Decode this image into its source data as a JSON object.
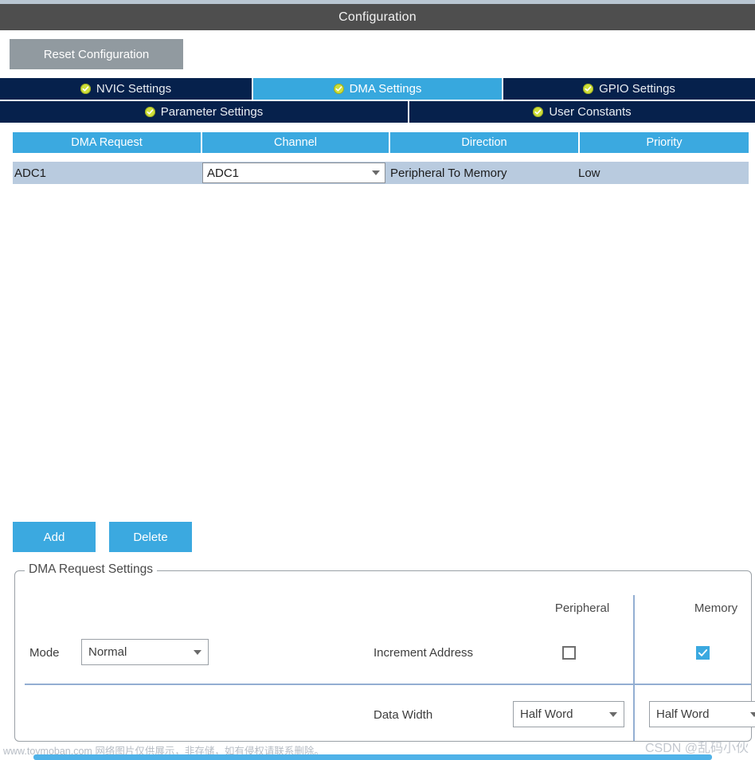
{
  "window": {
    "title": "Configuration"
  },
  "toolbar": {
    "reset_label": "Reset Configuration"
  },
  "tabs": {
    "row1": [
      {
        "label": "NVIC Settings",
        "icon": "check-circle-icon",
        "active": false
      },
      {
        "label": "DMA Settings",
        "icon": "check-circle-icon",
        "active": true
      },
      {
        "label": "GPIO Settings",
        "icon": "check-circle-icon",
        "active": false
      }
    ],
    "row2": [
      {
        "label": "Parameter Settings",
        "icon": "check-circle-icon",
        "active": false
      },
      {
        "label": "User Constants",
        "icon": "check-circle-icon",
        "active": false
      }
    ]
  },
  "table": {
    "headers": [
      "DMA Request",
      "Channel",
      "Direction",
      "Priority"
    ],
    "rows": [
      {
        "dma_request": "ADC1",
        "channel": "ADC1",
        "direction": "Peripheral To Memory",
        "priority": "Low",
        "selected": true
      }
    ]
  },
  "actions": {
    "add_label": "Add",
    "delete_label": "Delete"
  },
  "settings": {
    "legend": "DMA Request Settings",
    "column_headers": {
      "peripheral": "Peripheral",
      "memory": "Memory"
    },
    "mode": {
      "label": "Mode",
      "value": "Normal"
    },
    "increment_address": {
      "label": "Increment Address",
      "peripheral_checked": false,
      "memory_checked": true
    },
    "data_width": {
      "label": "Data Width",
      "peripheral_value": "Half Word",
      "memory_value": "Half Word"
    }
  },
  "watermarks": {
    "left": "www.toymoban.com 网络图片仅供展示，非存储，如有侵权请联系删除。",
    "right": "CSDN @乱码小伙"
  },
  "colors": {
    "titlebar": "#4e4e4e",
    "tab_inactive": "#06214c",
    "tab_active": "#37a8de",
    "accent_blue": "#3ba9e0",
    "row_selected": "#b9cbdf",
    "reset_button": "#919aa0",
    "check_badge": "#cfe03a"
  }
}
